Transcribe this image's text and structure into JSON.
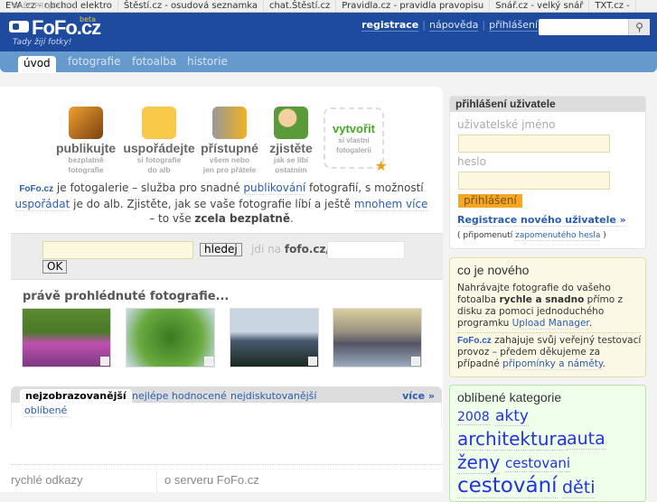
{
  "projects": {
    "label": "NAŠE PROJEKTY",
    "items": [
      "EVA.cz - obchod elektro",
      "Štěstí.cz - osudová seznamka",
      "chat.Štěstí.cz",
      "Pravidla.cz - pravidla pravopisu",
      "Snář.cz - velký snář",
      "TXT.cz -"
    ]
  },
  "header": {
    "logo": "FoFo.cz",
    "beta": "beta",
    "slogan": "Tady žijí fotky!",
    "links": {
      "register": "registrace",
      "help": "nápověda",
      "login": "přihlášení"
    },
    "search_placeholder": ""
  },
  "nav": [
    "úvod",
    "fotografie",
    "fotoalba",
    "historie"
  ],
  "features": [
    {
      "title": "publikujte",
      "sub1": "bezplatně",
      "sub2": "fotografie"
    },
    {
      "title": "uspořádejte",
      "sub1": "si fotografie",
      "sub2": "do alb"
    },
    {
      "title": "přístupné",
      "sub1": "všem nebo",
      "sub2": "jen pro přátele"
    },
    {
      "title": "zjistěte",
      "sub1": "jak se líbí",
      "sub2": "ostatním"
    }
  ],
  "create": {
    "title": "vytvořit",
    "sub1": "si vlastní",
    "sub2": "fotogalerii"
  },
  "intro": {
    "logo": "FoFo.cz",
    "t1": " je fotogalerie – služba pro snadné ",
    "l1": "publikování",
    "t2": " fotografií, s možností ",
    "l2": "uspořádat",
    "t3": " je do alb. Zjistěte, jak se vaše fotografie líbí a ještě ",
    "l3": "mnohem více",
    "t4": " – to vše ",
    "b": "zcela bezplatně",
    "t5": "."
  },
  "search": {
    "button": "hledej",
    "goto": "jdi na",
    "domain": "fofo.cz/",
    "ok": "OK"
  },
  "recent": {
    "title": "právě prohlédnuté fotografie..."
  },
  "tabs": {
    "items": [
      "nejzobrazovanější",
      "nejlépe hodnocené",
      "nejdiskutovanější"
    ],
    "more": "více »",
    "second_row": "oblíbené"
  },
  "footer": {
    "col1": "rychlé odkazy",
    "col2": "o serveru FoFo.cz"
  },
  "login": {
    "title": "přihlášení uživatele",
    "username": "uživatelské jméno",
    "password": "heslo",
    "button": "přihlášení",
    "register": "Registrace nového uživatele »",
    "remind_pre": "( připomenutí ",
    "remind_link": "zapomenutého hesla",
    "remind_post": " )"
  },
  "news": {
    "title": "co je nového",
    "p1a": "Nahrávajte fotografie do vašeho fotoalba ",
    "p1b": "rychle a snadno",
    "p1c": " přímo z disku za pomoci jednoduchého programku ",
    "p1link": "Upload Manager",
    "p1d": ".",
    "logo": "FoFo.cz",
    "p2a": " zahajuje svůj veřejný testovací provoz – předem děkujeme za případné ",
    "p2link": "připomínky a náměty",
    "p2b": "."
  },
  "categories": {
    "title": "oblíbené kategorie",
    "tags": [
      "2008",
      "akty",
      "architektura",
      "auta",
      "ženy",
      "cestovani",
      "cestování",
      "děti"
    ]
  }
}
